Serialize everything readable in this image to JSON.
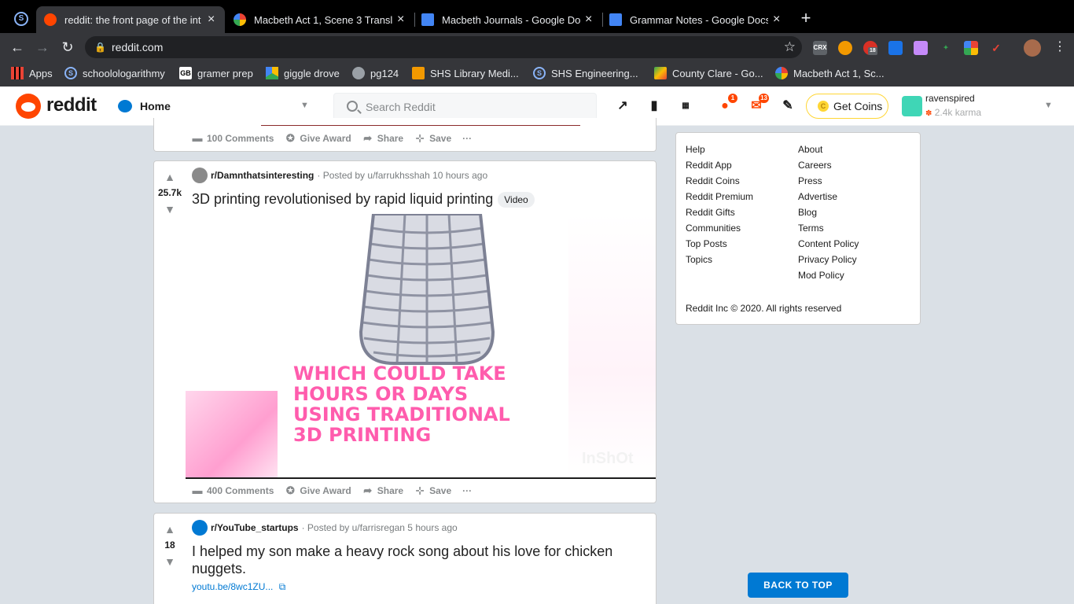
{
  "browser": {
    "tabs": [
      {
        "title": "reddit: the front page of the int",
        "active": true
      },
      {
        "title": "Macbeth Act 1, Scene 3 Transla",
        "active": false
      },
      {
        "title": "Macbeth Journals - Google Doc",
        "active": false
      },
      {
        "title": "Grammar Notes - Google Docs",
        "active": false
      }
    ],
    "close_glyph": "×",
    "new_tab_glyph": "+",
    "url": "reddit.com",
    "ext_crx": "CRX",
    "ext_badge": "18",
    "bookmarks": [
      "Apps",
      "schoolologarithmy",
      "gramer prep",
      "giggle drove",
      "pg124",
      "SHS Library Medi...",
      "SHS Engineering...",
      "County Clare - Go...",
      "Macbeth Act 1, Sc..."
    ]
  },
  "header": {
    "logo_text": "reddit",
    "feed_label": "Home",
    "search_placeholder": "Search Reddit",
    "chat_badge": "1",
    "inbox_badge": "13",
    "get_coins": "Get Coins",
    "username": "ravenspired",
    "karma": "2.4k karma"
  },
  "posts": [
    {
      "comments": "100 Comments",
      "give_award": "Give Award",
      "share": "Share",
      "save": "Save",
      "more": "···"
    },
    {
      "votes": "25.7k",
      "subreddit": "r/Damnthatsinteresting",
      "meta": "· Posted by u/farrukhsshah 10 hours ago",
      "title": "3D printing revolutionised by rapid liquid printing",
      "flair": "Video",
      "video_caption": "WHICH COULD TAKE HOURS OR DAYS USING TRADITIONAL 3D PRINTING",
      "watermark": "InShOt",
      "comments": "400 Comments",
      "give_award": "Give Award",
      "share": "Share",
      "save": "Save",
      "more": "···"
    },
    {
      "votes": "18",
      "subreddit": "r/YouTube_startups",
      "meta": "· Posted by u/farrisregan 5 hours ago",
      "title": "I helped my son make a heavy rock song about his love for chicken nuggets.",
      "link": "youtu.be/8wc1ZU..."
    }
  ],
  "footer": {
    "col1": [
      "Help",
      "Reddit App",
      "Reddit Coins",
      "Reddit Premium",
      "Reddit Gifts",
      "Communities",
      "Top Posts",
      "Topics"
    ],
    "col2": [
      "About",
      "Careers",
      "Press",
      "Advertise",
      "Blog",
      "Terms",
      "Content Policy",
      "Privacy Policy",
      "Mod Policy"
    ],
    "copyright": "Reddit Inc © 2020. All rights reserved"
  },
  "back_to_top": "BACK TO TOP",
  "colors": {
    "reddit_orange": "#ff4500",
    "reddit_blue": "#0079d3",
    "caption_pink": "#ff5cad",
    "coin_yellow": "#ffd635"
  }
}
